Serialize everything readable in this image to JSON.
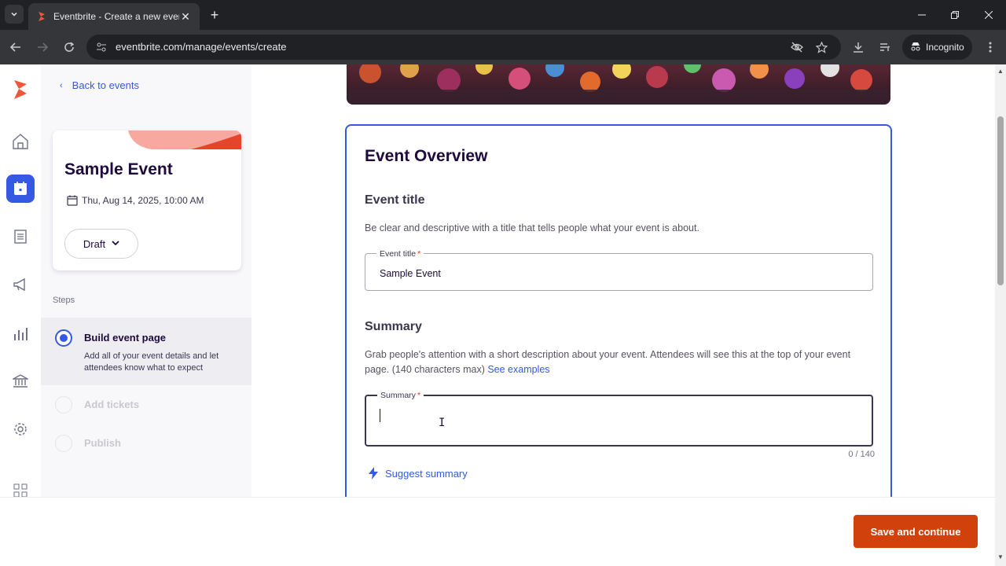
{
  "browser": {
    "tab_title": "Eventbrite - Create a new event",
    "new_tab_symbol": "+",
    "url": "eventbrite.com/manage/events/create",
    "mode_label": "Incognito"
  },
  "rail": {
    "icons": [
      "home-icon",
      "calendar-icon",
      "orders-list-icon",
      "megaphone-icon",
      "reports-chart-icon",
      "finance-bank-icon",
      "settings-gear-icon",
      "apps-grid-icon"
    ],
    "active": "calendar-icon"
  },
  "sidebar": {
    "back_label": "Back to events",
    "event": {
      "title": "Sample Event",
      "date": "Thu, Aug 14, 2025, 10:00 AM",
      "status": "Draft"
    },
    "steps_label": "Steps",
    "steps": [
      {
        "title": "Build event page",
        "description": "Add all of your event details and let attendees know what to expect",
        "state": "active"
      },
      {
        "title": "Add tickets",
        "state": "disabled"
      },
      {
        "title": "Publish",
        "state": "disabled"
      }
    ]
  },
  "overview": {
    "heading": "Event Overview",
    "event_title_section": {
      "title": "Event title",
      "description": "Be clear and descriptive with a title that tells people what your event is about.",
      "field_label": "Event title",
      "required_mark": "*",
      "value": "Sample Event"
    },
    "summary_section": {
      "title": "Summary",
      "description": "Grab people's attention with a short description about your event. Attendees will see this at the top of your event page. (140 characters max)",
      "examples_link": "See examples",
      "field_label": "Summary",
      "required_mark": "*",
      "value": "",
      "counter": "0 / 140"
    },
    "suggest_label": "Suggest summary"
  },
  "footer": {
    "save_label": "Save and continue"
  },
  "colors": {
    "accent_blue": "#3659e3",
    "brand_orange": "#d1410c",
    "text_dark": "#1e0a3c"
  }
}
